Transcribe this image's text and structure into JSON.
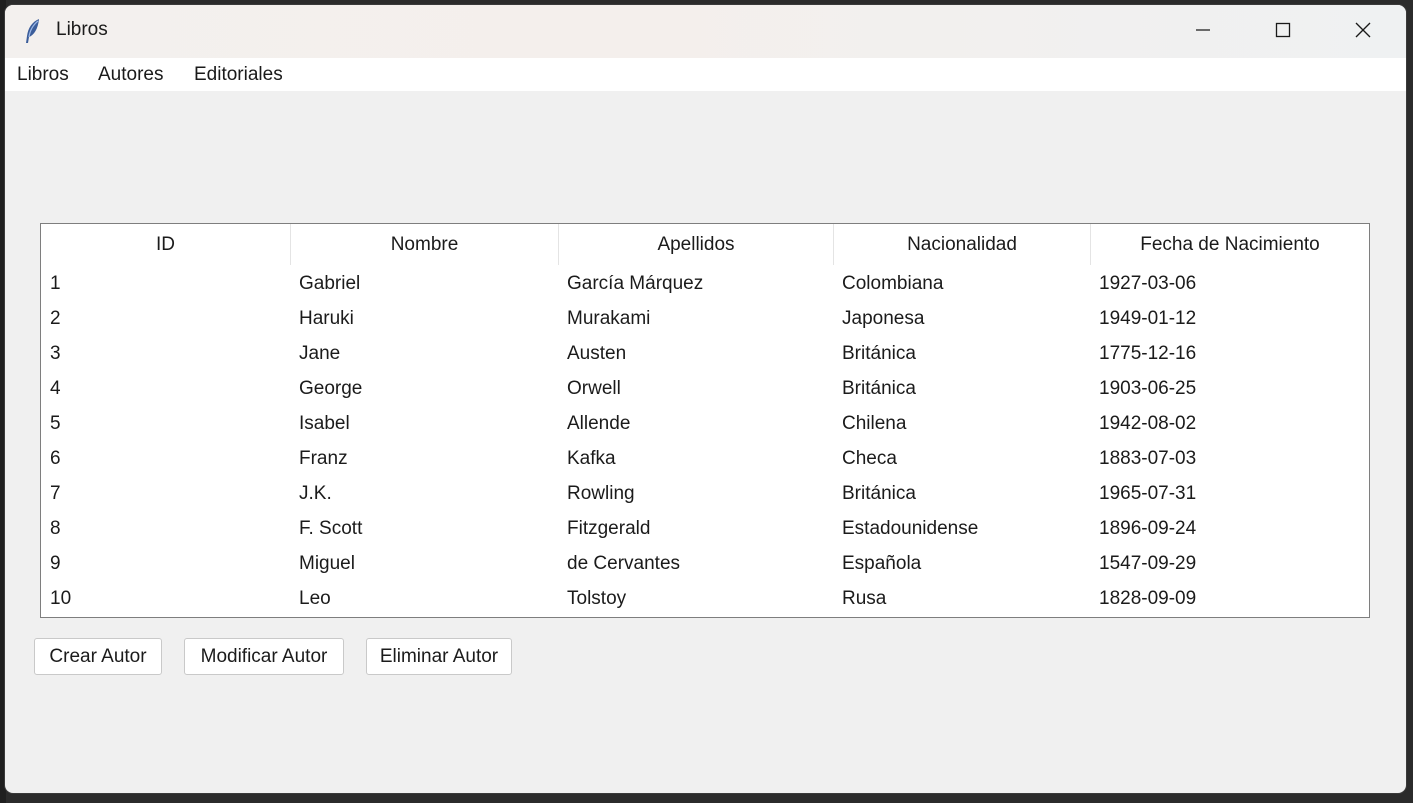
{
  "window": {
    "title": "Libros",
    "controls": [
      "minimize-icon",
      "maximize-icon",
      "close-icon"
    ]
  },
  "menubar": {
    "items": [
      {
        "label": "Libros"
      },
      {
        "label": "Autores"
      },
      {
        "label": "Editoriales"
      }
    ]
  },
  "table": {
    "columns": [
      "ID",
      "Nombre",
      "Apellidos",
      "Nacionalidad",
      "Fecha de Nacimiento"
    ],
    "rows": [
      [
        "1",
        "Gabriel",
        "García Márquez",
        "Colombiana",
        "1927-03-06"
      ],
      [
        "2",
        "Haruki",
        "Murakami",
        "Japonesa",
        "1949-01-12"
      ],
      [
        "3",
        "Jane",
        "Austen",
        "Británica",
        "1775-12-16"
      ],
      [
        "4",
        "George",
        "Orwell",
        "Británica",
        "1903-06-25"
      ],
      [
        "5",
        "Isabel",
        "Allende",
        "Chilena",
        "1942-08-02"
      ],
      [
        "6",
        "Franz",
        "Kafka",
        "Checa",
        "1883-07-03"
      ],
      [
        "7",
        "J.K.",
        "Rowling",
        "Británica",
        "1965-07-31"
      ],
      [
        "8",
        "F. Scott",
        "Fitzgerald",
        "Estadounidense",
        "1896-09-24"
      ],
      [
        "9",
        "Miguel",
        "de Cervantes",
        "Española",
        "1547-09-29"
      ],
      [
        "10",
        "Leo",
        "Tolstoy",
        "Rusa",
        "1828-09-09"
      ]
    ]
  },
  "buttons": {
    "crear": "Crear Autor",
    "modificar": "Modificar Autor",
    "eliminar": "Eliminar Autor"
  }
}
